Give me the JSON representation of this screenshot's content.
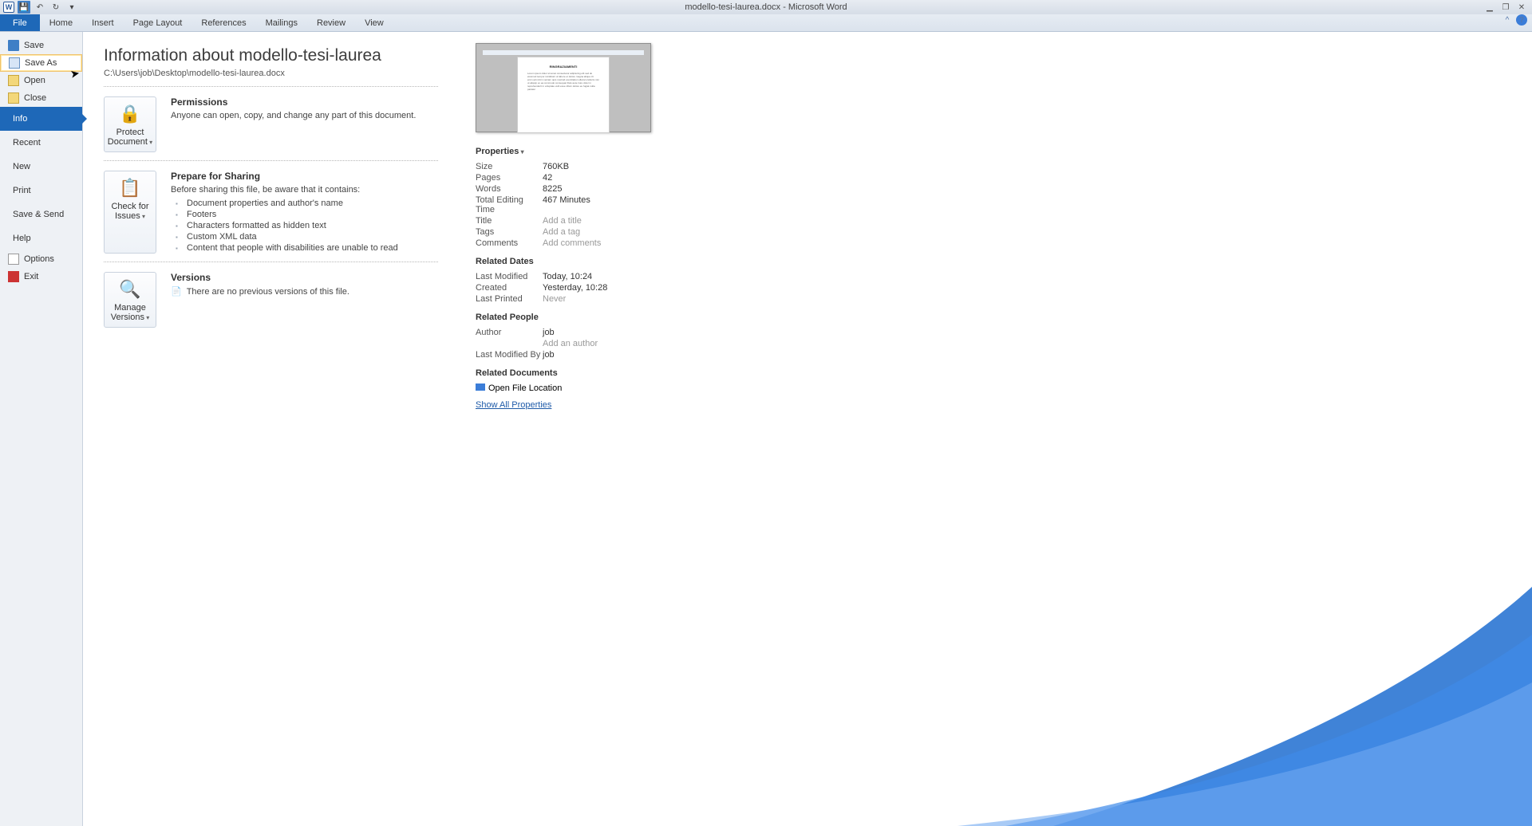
{
  "titlebar": {
    "title": "modello-tesi-laurea.docx - Microsoft Word"
  },
  "ribbon": {
    "tabs": [
      "File",
      "Home",
      "Insert",
      "Page Layout",
      "References",
      "Mailings",
      "Review",
      "View"
    ]
  },
  "sidebar": {
    "save": "Save",
    "saveas": "Save As",
    "open": "Open",
    "close": "Close",
    "info": "Info",
    "recent": "Recent",
    "new": "New",
    "print": "Print",
    "savesend": "Save & Send",
    "help": "Help",
    "options": "Options",
    "exit": "Exit"
  },
  "main": {
    "title": "Information about modello-tesi-laurea",
    "path": "C:\\Users\\job\\Desktop\\modello-tesi-laurea.docx",
    "perm": {
      "h": "Permissions",
      "p": "Anyone can open, copy, and change any part of this document.",
      "btn": "Protect Document"
    },
    "share": {
      "h": "Prepare for Sharing",
      "p": "Before sharing this file, be aware that it contains:",
      "btn": "Check for Issues",
      "items": [
        "Document properties and author's name",
        "Footers",
        "Characters formatted as hidden text",
        "Custom XML data",
        "Content that people with disabilities are unable to read"
      ]
    },
    "ver": {
      "h": "Versions",
      "p": "There are no previous versions of this file.",
      "btn": "Manage Versions"
    }
  },
  "props": {
    "header": "Properties",
    "rows": [
      {
        "k": "Size",
        "v": "760KB"
      },
      {
        "k": "Pages",
        "v": "42"
      },
      {
        "k": "Words",
        "v": "8225"
      },
      {
        "k": "Total Editing Time",
        "v": "467 Minutes"
      },
      {
        "k": "Title",
        "v": "Add a title",
        "ph": true
      },
      {
        "k": "Tags",
        "v": "Add a tag",
        "ph": true
      },
      {
        "k": "Comments",
        "v": "Add comments",
        "ph": true
      }
    ],
    "dates": {
      "h": "Related Dates",
      "rows": [
        {
          "k": "Last Modified",
          "v": "Today, 10:24"
        },
        {
          "k": "Created",
          "v": "Yesterday, 10:28"
        },
        {
          "k": "Last Printed",
          "v": "Never",
          "ph": true
        }
      ]
    },
    "people": {
      "h": "Related People",
      "author_k": "Author",
      "author_v": "job",
      "addauthor": "Add an author",
      "lmb_k": "Last Modified By",
      "lmb_v": "job"
    },
    "docs": {
      "h": "Related Documents",
      "open": "Open File Location"
    },
    "showall": "Show All Properties"
  },
  "preview": {
    "title": "RINGRAZIAMENTI"
  }
}
